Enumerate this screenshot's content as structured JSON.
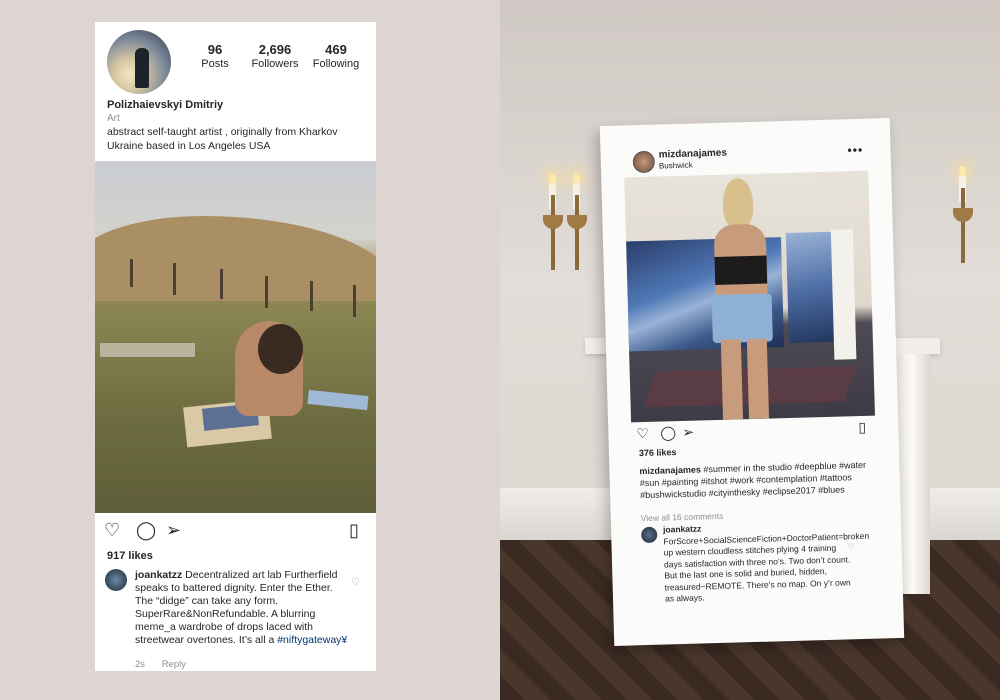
{
  "left_post": {
    "stats": [
      {
        "num": "96",
        "label": "Posts"
      },
      {
        "num": "2,696",
        "label": "Followers"
      },
      {
        "num": "469",
        "label": "Following"
      }
    ],
    "profile_name": "Polizhaievskyi Dmitriy",
    "category": "Art",
    "bio": "abstract self-taught artist , originally from Kharkov Ukraine based in Los Angeles USA",
    "likes": "917 likes",
    "comment_user": "joankatzz",
    "comment_text": " Decentralized art lab Furtherfield speaks to battered dignity. Enter the Ether. The “didge” can take any form. SuperRare&NonRefundable. A blurring meme_a wardrobe of drops laced with streetwear overtones. It’s all a ",
    "comment_hashtag": "#niftygateway¥",
    "comment_time": "2s",
    "reply_label": "Reply",
    "icons": [
      "heart-icon",
      "comment-icon",
      "share-icon",
      "bookmark-icon"
    ]
  },
  "right_post": {
    "username": "mizdanajames",
    "location": "Bushwick",
    "more_label": "•••",
    "likes": "376 likes",
    "caption_user": "mizdanajames",
    "caption_text": " #summer in the studio #deepblue #water #sun #painting #itshot #work #contemplation #tattoos #bushwickstudio #cityinthesky #eclipse2017 #blues",
    "view_comments": "View all 16 comments",
    "comment_user": "joankatzz",
    "comment_text": "ForScore+SocialScienceFiction+DoctorPatient=broken up western cloudless stitches plying 4 training days satisfaction with three no’s. Two don’t count. But the last one is solid and buried, hidden, treasured~REMOTE. There’s no map. On y’r own as always."
  },
  "colors": {
    "text": "#262626",
    "muted": "#8e8e8e",
    "hashtag": "#00376b",
    "left_background": "#dcd5d1"
  }
}
